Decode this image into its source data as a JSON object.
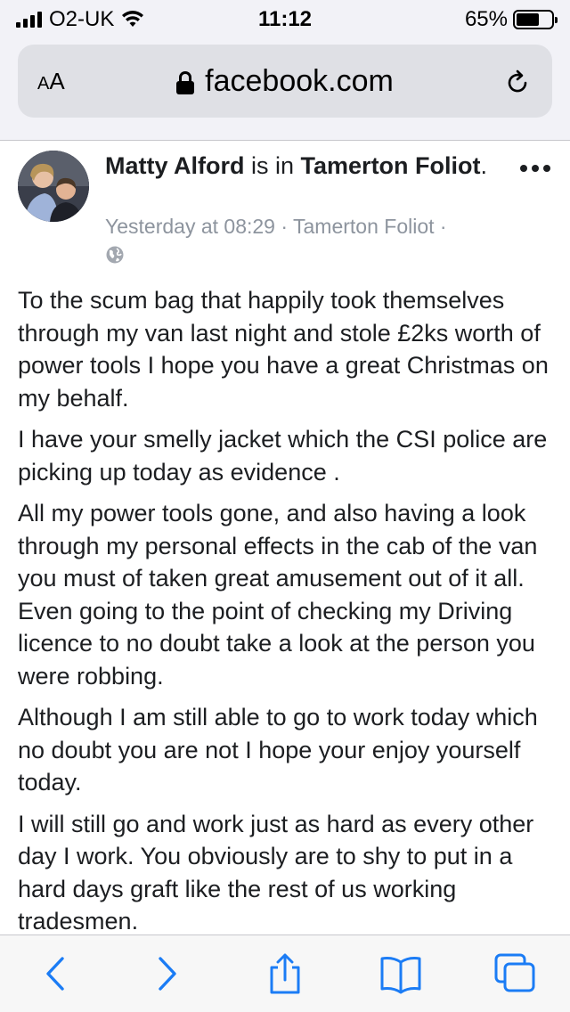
{
  "status_bar": {
    "carrier": "O2-UK",
    "time": "11:12",
    "battery": "65%",
    "battery_level": 0.65
  },
  "browser": {
    "text_size_label": "AA",
    "url": "facebook.com"
  },
  "post": {
    "author": "Matty Alford",
    "is_in_text": " is in ",
    "location": "Tamerton Foliot",
    "location_suffix": ".",
    "timestamp": "Yesterday at 08:29",
    "meta_sep": " · ",
    "meta_location": "Tamerton Foliot",
    "meta_trailing": " ·",
    "paragraphs": [
      "To the scum bag that happily took themselves through my van last night and stole £2ks worth of power tools I hope you have a great Christmas on my behalf.",
      "I have your smelly jacket which the CSI police are picking up today as evidence .",
      "All my power tools gone, and also having a look through my personal effects in the cab of the van you must of taken great amusement out of it all. Even going to the point of checking my Driving licence to no doubt take a look at the person you were robbing.",
      "Although I am still able to go to work today which no doubt you are not I hope your enjoy yourself today.",
      "I will still go and work just as hard as every other day I work. You obviously are to shy to put in a hard days graft like the rest of us working tradesmen."
    ]
  },
  "toolbar": {
    "icons": [
      "back-icon",
      "forward-icon",
      "share-icon",
      "bookmarks-icon",
      "tabs-icon"
    ],
    "accent_color": "#1b7cf5"
  }
}
